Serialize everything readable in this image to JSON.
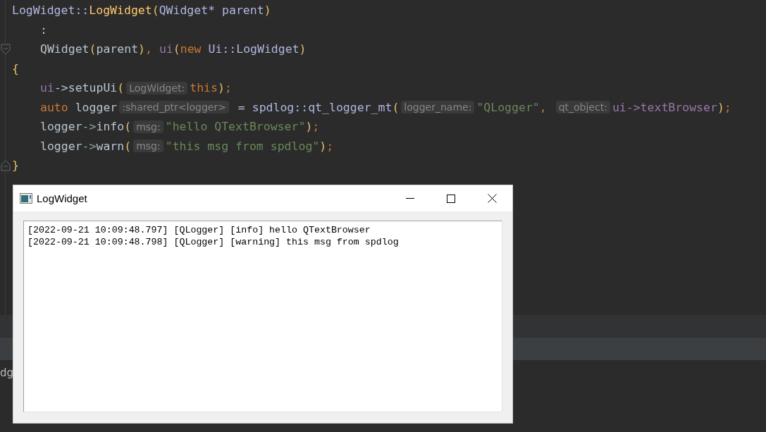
{
  "editor": {
    "lines": [
      {
        "indented": false,
        "fold_start": false,
        "fold_end": false,
        "tokens": [
          {
            "kind": "type",
            "text": "LogWidget::"
          },
          {
            "kind": "function",
            "text": "LogWidget"
          },
          {
            "kind": "paren",
            "text": "("
          },
          {
            "kind": "type",
            "text": "QWidget* parent"
          },
          {
            "kind": "paren",
            "text": ")"
          }
        ]
      },
      {
        "indented": true,
        "fold_start": false,
        "fold_end": false,
        "tokens": [
          {
            "kind": "plain",
            "text": ":"
          }
        ]
      },
      {
        "indented": true,
        "fold_start": true,
        "fold_end": false,
        "tokens": [
          {
            "kind": "plain",
            "text": "QWidget"
          },
          {
            "kind": "paren",
            "text": "("
          },
          {
            "kind": "plain",
            "text": "parent"
          },
          {
            "kind": "paren",
            "text": ")"
          },
          {
            "kind": "keyword",
            "text": ", "
          },
          {
            "kind": "member",
            "text": "ui"
          },
          {
            "kind": "paren",
            "text": "("
          },
          {
            "kind": "keyword",
            "text": "new "
          },
          {
            "kind": "type",
            "text": "Ui::LogWidget"
          },
          {
            "kind": "paren",
            "text": ")"
          }
        ]
      },
      {
        "indented": false,
        "fold_start": false,
        "fold_end": false,
        "tokens": [
          {
            "kind": "paren",
            "text": "{"
          }
        ]
      },
      {
        "indented": true,
        "fold_start": false,
        "fold_end": false,
        "tokens": [
          {
            "kind": "member",
            "text": "ui"
          },
          {
            "kind": "plain",
            "text": "->setupUi"
          },
          {
            "kind": "paren",
            "text": "("
          },
          {
            "kind": "hint",
            "text": "LogWidget:"
          },
          {
            "kind": "keyword",
            "text": "this"
          },
          {
            "kind": "paren",
            "text": ")"
          },
          {
            "kind": "keyword",
            "text": ";"
          }
        ]
      },
      {
        "indented": true,
        "fold_start": false,
        "fold_end": false,
        "tokens": [
          {
            "kind": "keyword",
            "text": "auto "
          },
          {
            "kind": "plain",
            "text": "logger"
          },
          {
            "kind": "hint",
            "text": ":shared_ptr<logger>"
          },
          {
            "kind": "plain",
            "text": " = "
          },
          {
            "kind": "type",
            "text": "spdlog::qt_logger_mt"
          },
          {
            "kind": "paren",
            "text": "("
          },
          {
            "kind": "hint",
            "text": "logger_name:"
          },
          {
            "kind": "string",
            "text": "\"QLogger\""
          },
          {
            "kind": "keyword",
            "text": ", "
          },
          {
            "kind": "hint",
            "text": "qt_object:"
          },
          {
            "kind": "member",
            "text": "ui->textBrowser"
          },
          {
            "kind": "paren",
            "text": ")"
          },
          {
            "kind": "keyword",
            "text": ";"
          }
        ]
      },
      {
        "indented": true,
        "fold_start": false,
        "fold_end": false,
        "tokens": [
          {
            "kind": "plain",
            "text": "logger"
          },
          {
            "kind": "arrow",
            "text": "->"
          },
          {
            "kind": "plain",
            "text": "info"
          },
          {
            "kind": "paren",
            "text": "("
          },
          {
            "kind": "hint",
            "text": "msg:"
          },
          {
            "kind": "string",
            "text": "\"hello QTextBrowser\""
          },
          {
            "kind": "paren",
            "text": ")"
          },
          {
            "kind": "keyword",
            "text": ";"
          }
        ]
      },
      {
        "indented": true,
        "fold_start": false,
        "fold_end": false,
        "tokens": [
          {
            "kind": "plain",
            "text": "logger"
          },
          {
            "kind": "arrow",
            "text": "->"
          },
          {
            "kind": "plain",
            "text": "warn"
          },
          {
            "kind": "paren",
            "text": "("
          },
          {
            "kind": "hint",
            "text": "msg:"
          },
          {
            "kind": "string",
            "text": "\"this msg from spdlog\""
          },
          {
            "kind": "paren",
            "text": ")"
          },
          {
            "kind": "keyword",
            "text": ";"
          }
        ]
      },
      {
        "indented": false,
        "fold_start": false,
        "fold_end": true,
        "tokens": [
          {
            "kind": "paren",
            "text": "}"
          }
        ]
      }
    ]
  },
  "bottom_panel": {
    "text": "dg"
  },
  "window": {
    "title": "LogWidget",
    "log_lines": [
      "[2022-09-21 10:09:48.797] [QLogger] [info] hello QTextBrowser",
      "[2022-09-21 10:09:48.798] [QLogger] [warning] this msg from spdlog"
    ]
  }
}
